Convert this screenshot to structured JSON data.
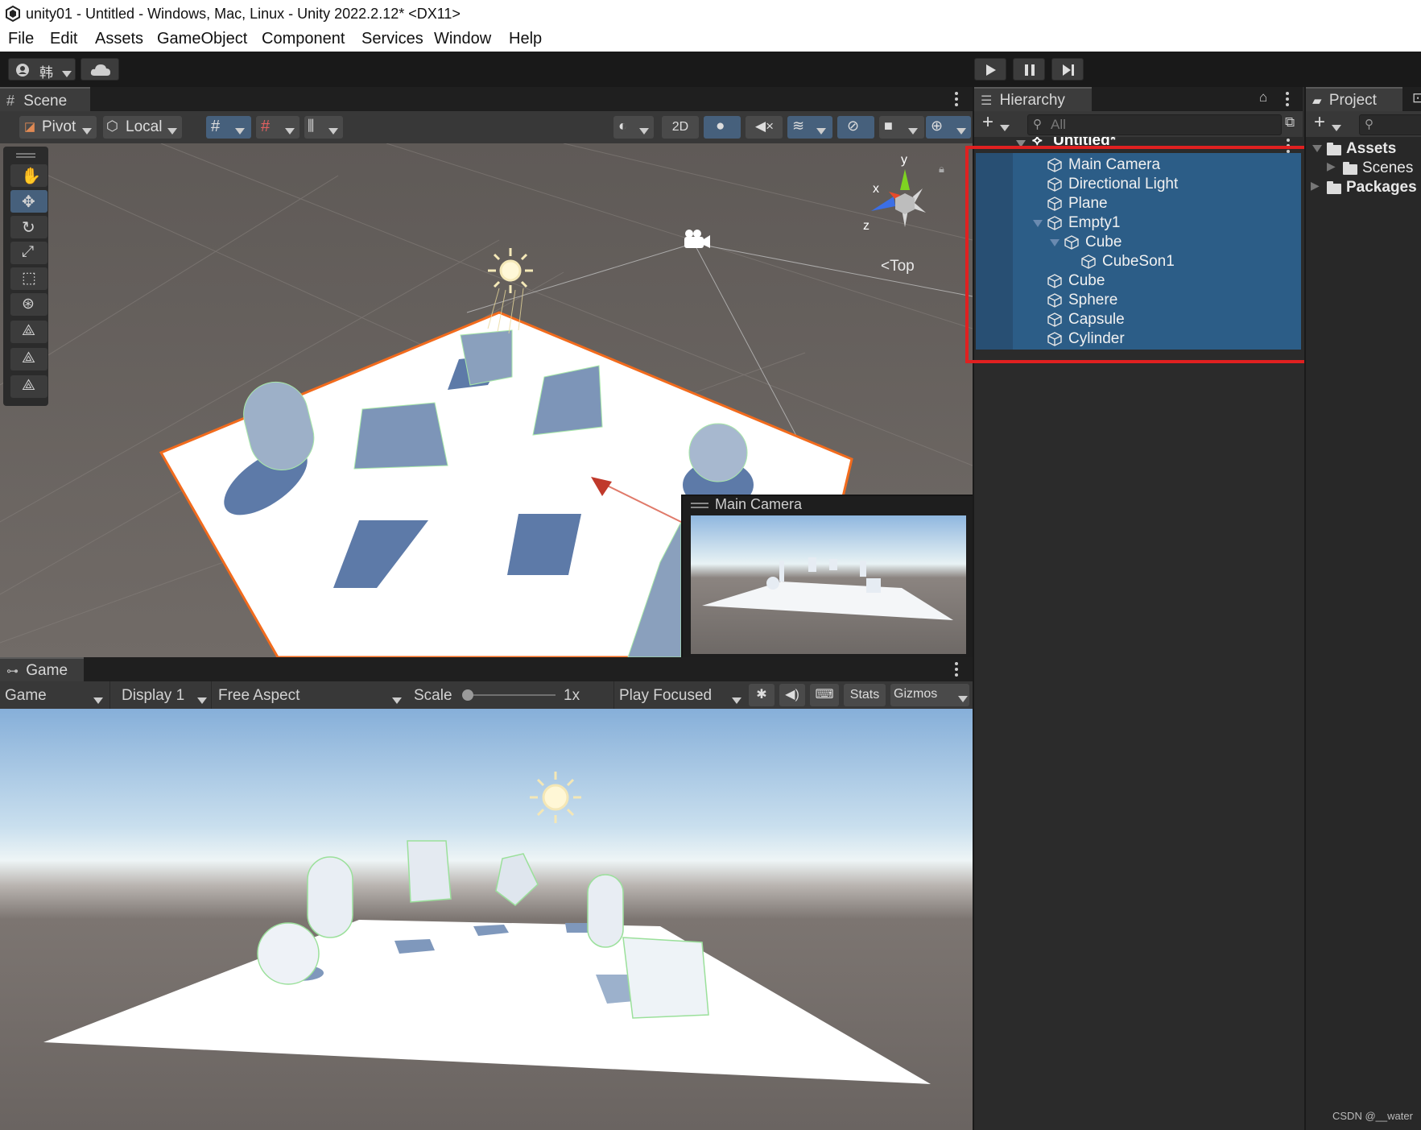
{
  "window": {
    "title": "unity01 - Untitled - Windows, Mac, Linux - Unity 2022.2.12* <DX11>"
  },
  "menu": [
    "File",
    "Edit",
    "Assets",
    "GameObject",
    "Component",
    "Services",
    "Window",
    "Help"
  ],
  "toolbar": {
    "account_label": "韩",
    "play_icon": "play-icon",
    "pause_icon": "pause-icon",
    "step_icon": "step-icon"
  },
  "scene": {
    "tab": "Scene",
    "pivot": "Pivot",
    "local": "Local",
    "mode_2d": "2D",
    "gizmo_axes": {
      "x": "x",
      "y": "y",
      "z": "z"
    },
    "view_label": "Top",
    "camera_preview_title": "Main Camera"
  },
  "hierarchy": {
    "tab": "Hierarchy",
    "search_placeholder": "All",
    "scene_name": "Untitled*",
    "items": [
      {
        "label": "Main Camera",
        "depth": 0,
        "expanded": null
      },
      {
        "label": "Directional Light",
        "depth": 0,
        "expanded": null
      },
      {
        "label": "Plane",
        "depth": 0,
        "expanded": null
      },
      {
        "label": "Empty1",
        "depth": 0,
        "expanded": true
      },
      {
        "label": "Cube",
        "depth": 1,
        "expanded": true
      },
      {
        "label": "CubeSon1",
        "depth": 2,
        "expanded": null
      },
      {
        "label": "Cube",
        "depth": 0,
        "expanded": null
      },
      {
        "label": "Sphere",
        "depth": 0,
        "expanded": null
      },
      {
        "label": "Capsule",
        "depth": 0,
        "expanded": null
      },
      {
        "label": "Cylinder",
        "depth": 0,
        "expanded": null
      }
    ],
    "selection_color": "#2c5d87",
    "highlight_box_color": "#e02020"
  },
  "project": {
    "tab": "Project",
    "tree": [
      {
        "label": "Assets",
        "bold": true
      },
      {
        "label": "Scenes",
        "bold": false
      },
      {
        "label": "Packages",
        "bold": true
      }
    ]
  },
  "game": {
    "tab": "Game",
    "mode": "Game",
    "display": "Display 1",
    "aspect": "Free Aspect",
    "scale_label": "Scale",
    "scale_value": "1x",
    "play_mode": "Play Focused",
    "stats": "Stats",
    "gizmos": "Gizmos"
  },
  "watermark": "CSDN @__water"
}
